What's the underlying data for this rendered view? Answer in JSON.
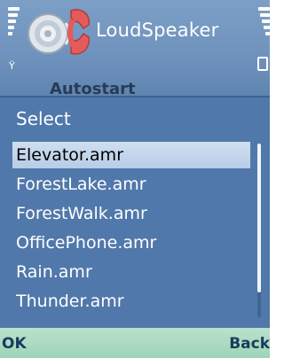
{
  "app": {
    "title": "LoudSpeaker",
    "background_label": "Autostart"
  },
  "dialog": {
    "title": "Select",
    "items": [
      {
        "label": "Elevator.amr",
        "selected": true
      },
      {
        "label": "ForestLake.amr",
        "selected": false
      },
      {
        "label": "ForestWalk.amr",
        "selected": false
      },
      {
        "label": "OfficePhone.amr",
        "selected": false
      },
      {
        "label": "Rain.amr",
        "selected": false
      },
      {
        "label": "Thunder.amr",
        "selected": false
      }
    ]
  },
  "softkeys": {
    "left": "OK",
    "right": "Back"
  },
  "colors": {
    "header": "#6f93bd",
    "dialog": "#5078aa",
    "selection": "#c4d7ec",
    "softkey_bar": "#a8d8bf"
  },
  "icons": [
    "signal-strength-icon",
    "battery-icon",
    "speaker-phone-icon"
  ]
}
